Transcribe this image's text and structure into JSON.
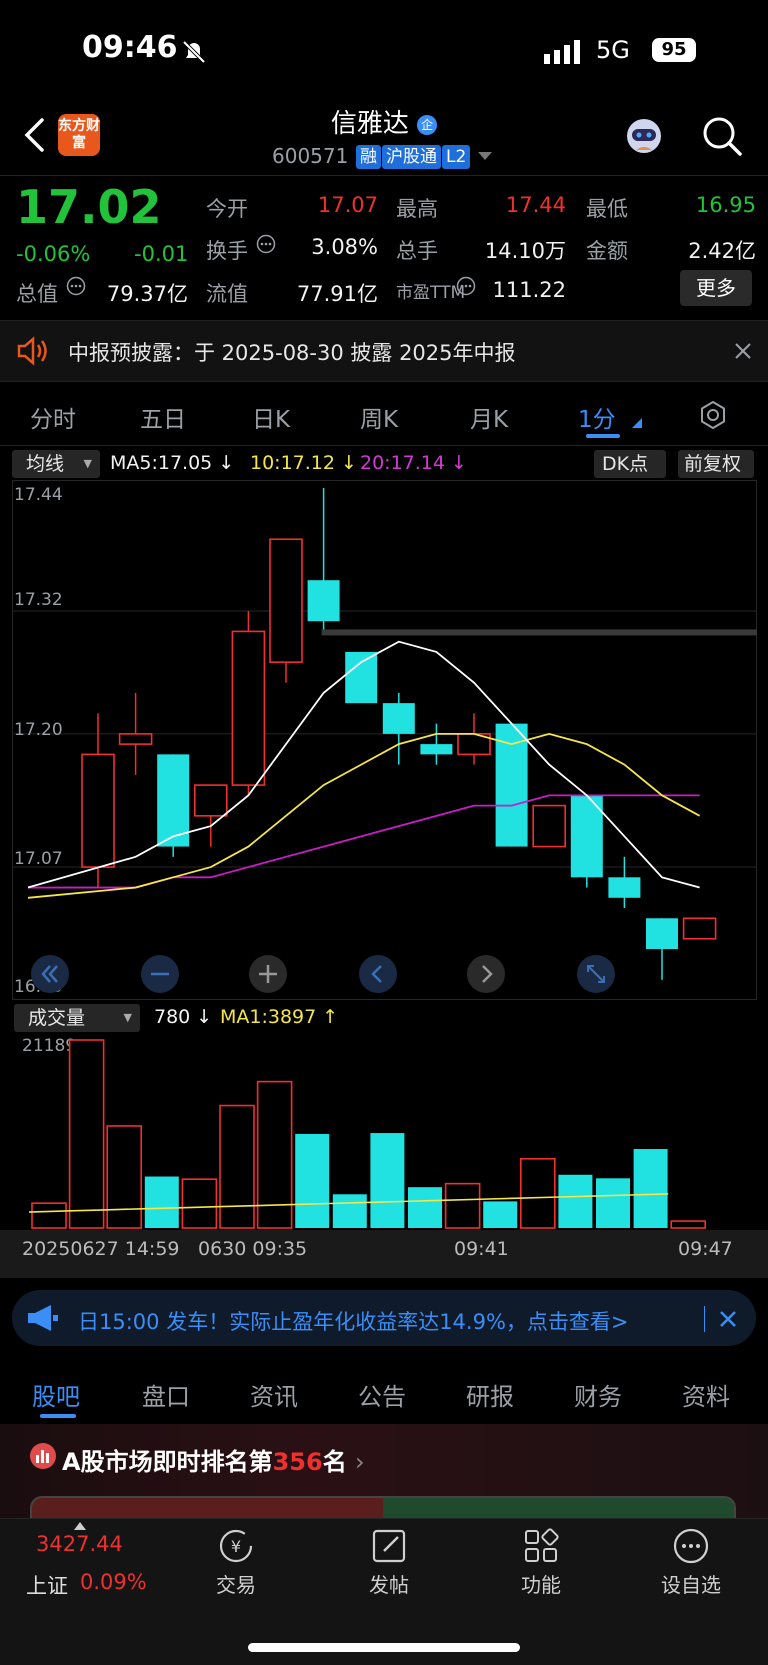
{
  "status_bar": {
    "time": "09:46",
    "network": "5G",
    "battery": "95"
  },
  "header": {
    "logo_text": "东方财富",
    "stock_name": "信雅达",
    "stock_code": "600571",
    "tags": [
      "融",
      "沪股通",
      "L2"
    ]
  },
  "quote": {
    "price": "17.02",
    "change_pct": "-0.06%",
    "change": "-0.01",
    "open_label": "今开",
    "open": "17.07",
    "high_label": "最高",
    "high": "17.44",
    "low_label": "最低",
    "low": "16.95",
    "turnover_label": "换手",
    "turnover": "3.08%",
    "volume_label": "总手",
    "volume": "14.10万",
    "amount_label": "金额",
    "amount": "2.42亿",
    "mktcap_label": "总值",
    "mktcap": "79.37亿",
    "float_label": "流值",
    "float": "77.91亿",
    "pe_label": "市盈TTM",
    "pe": "111.22",
    "more_label": "更多"
  },
  "notice": {
    "text": "中报预披露：于 2025-08-30 披露 2025年中报"
  },
  "chart_tabs": [
    "分时",
    "五日",
    "日K",
    "周K",
    "月K",
    "1分"
  ],
  "indicators": {
    "ma_select": "均线",
    "ma5": "MA5:17.05",
    "ma10": "10:17.12",
    "ma20": "20:17.14",
    "dk_label": "DK点",
    "adjust_label": "前复权",
    "vol_select": "成交量",
    "vol_value": "780",
    "vol_ma1": "MA1:3897"
  },
  "colors": {
    "up": "#f0302f",
    "down": "#22e1e1",
    "ma5": "#ffffff",
    "ma10": "#f5e64b",
    "ma20": "#c81ec8",
    "accent": "#3a8ef6"
  },
  "chart_data": {
    "type": "candlestick",
    "price_ticks": [
      "17.44",
      "17.32",
      "17.20",
      "17.07",
      "16.95"
    ],
    "ylim": [
      16.95,
      17.44
    ],
    "candles": [
      {
        "o": 17.07,
        "h": 17.22,
        "l": 17.05,
        "c": 17.18
      },
      {
        "o": 17.19,
        "h": 17.24,
        "l": 17.16,
        "c": 17.2
      },
      {
        "o": 17.18,
        "h": 17.18,
        "l": 17.08,
        "c": 17.09
      },
      {
        "o": 17.12,
        "h": 17.15,
        "l": 17.09,
        "c": 17.15
      },
      {
        "o": 17.15,
        "h": 17.32,
        "l": 17.14,
        "c": 17.3
      },
      {
        "o": 17.27,
        "h": 17.39,
        "l": 17.25,
        "c": 17.39
      },
      {
        "o": 17.35,
        "h": 17.44,
        "l": 17.3,
        "c": 17.31
      },
      {
        "o": 17.28,
        "h": 17.28,
        "l": 17.24,
        "c": 17.23
      },
      {
        "o": 17.23,
        "h": 17.24,
        "l": 17.17,
        "c": 17.2
      },
      {
        "o": 17.19,
        "h": 17.21,
        "l": 17.17,
        "c": 17.18
      },
      {
        "o": 17.18,
        "h": 17.22,
        "l": 17.17,
        "c": 17.2
      },
      {
        "o": 17.21,
        "h": 17.21,
        "l": 17.09,
        "c": 17.09
      },
      {
        "o": 17.09,
        "h": 17.13,
        "l": 17.09,
        "c": 17.13
      },
      {
        "o": 17.14,
        "h": 17.14,
        "l": 17.05,
        "c": 17.06
      },
      {
        "o": 17.06,
        "h": 17.08,
        "l": 17.03,
        "c": 17.04
      },
      {
        "o": 17.02,
        "h": 17.02,
        "l": 16.96,
        "c": 16.99
      },
      {
        "o": 17.0,
        "h": 17.02,
        "l": 17.0,
        "c": 17.02
      }
    ],
    "ma5": [
      17.05,
      17.08,
      17.1,
      17.11,
      17.14,
      17.19,
      17.24,
      17.27,
      17.29,
      17.28,
      17.25,
      17.21,
      17.17,
      17.14,
      17.1,
      17.06,
      17.05
    ],
    "ma10": [
      17.04,
      17.05,
      17.06,
      17.07,
      17.09,
      17.12,
      17.15,
      17.17,
      17.19,
      17.2,
      17.2,
      17.19,
      17.2,
      17.19,
      17.17,
      17.14,
      17.12
    ],
    "ma20": [
      17.05,
      17.05,
      17.06,
      17.06,
      17.07,
      17.08,
      17.09,
      17.1,
      17.11,
      17.12,
      17.13,
      17.13,
      17.14,
      17.14,
      17.14,
      17.14,
      17.14
    ],
    "volume_max_label": "21189",
    "volumes": [
      2800,
      21189,
      11500,
      5800,
      5500,
      13800,
      16500,
      10600,
      3800,
      10700,
      4600,
      5000,
      3000,
      7800,
      6000,
      5600,
      8900,
      780
    ],
    "volume_dirs": [
      "up",
      "up",
      "up",
      "down",
      "up",
      "up",
      "up",
      "down",
      "down",
      "down",
      "down",
      "up",
      "down",
      "up",
      "down",
      "down",
      "down",
      "up"
    ],
    "time_labels": [
      "20250627 14:59",
      "0630 09:35",
      "09:41",
      "09:47"
    ]
  },
  "promo": {
    "text": "日15:00 发车！实际止盈年化收益率达14.9%，点击查看>"
  },
  "bottom_tabs": [
    "股吧",
    "盘口",
    "资讯",
    "公告",
    "研报",
    "财务",
    "资料"
  ],
  "rank": {
    "prefix": "A股市场即时排名第",
    "number": "356",
    "suffix": "名"
  },
  "nav": {
    "index_value": "3427.44",
    "index_name": "上证",
    "index_change": "0.09%",
    "items": [
      "交易",
      "发帖",
      "功能",
      "设自选"
    ]
  }
}
